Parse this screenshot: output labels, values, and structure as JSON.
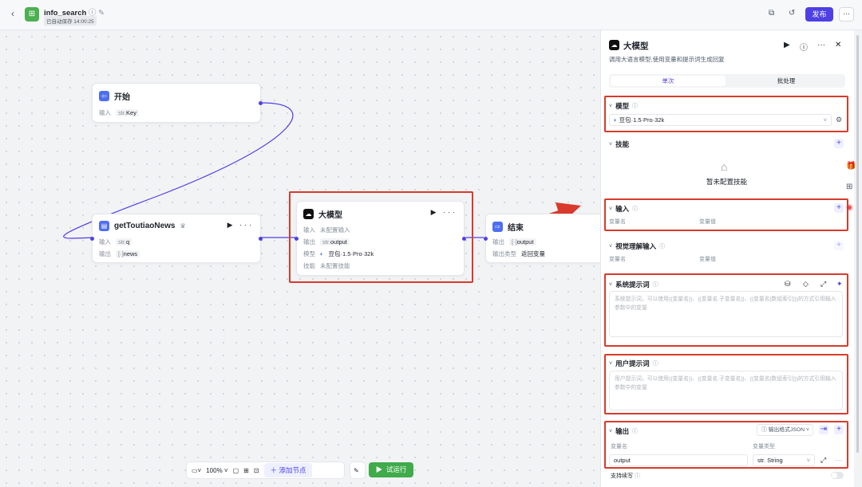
{
  "app": {
    "title": "info_search",
    "autosave": "已自动保存 14:00:25",
    "publish_label": "发布",
    "back_icon": "chevron-left-icon"
  },
  "colors": {
    "accent": "#4e40e5",
    "highlight": "#d93a2b",
    "run": "#3fab4b"
  },
  "nodes": {
    "start": {
      "title": "开始",
      "input_label": "输入",
      "input_type": "str.",
      "input_value": "Key"
    },
    "tool": {
      "title": "getToutiaoNews",
      "input_label": "输入",
      "input_type": "str.",
      "input_value": "q",
      "output_label": "输出",
      "output_type": "[·]",
      "output_value": "news"
    },
    "llm": {
      "title": "大模型",
      "input_label": "输入",
      "input_value": "未配置输入",
      "output_label": "输出",
      "output_type": "str.",
      "output_value": "output",
      "model_label": "模型",
      "model_value": "豆包·1.5·Pro·32k",
      "skill_label": "技能",
      "skill_value": "未配置技能"
    },
    "end": {
      "title": "结束",
      "output_label": "输出",
      "output_type": "[·]",
      "output_value": "output",
      "out_type_label": "输出类型",
      "out_type_value": "返回变量"
    }
  },
  "toolbar": {
    "zoom": "100%",
    "add_node": "添加节点",
    "test_run": "试运行"
  },
  "panel": {
    "title": "大模型",
    "desc": "调用大语言模型,使用变量和提示词生成回复",
    "tabs": [
      "单次",
      "批处理"
    ],
    "model": {
      "label": "模型",
      "value": "豆包·1.5·Pro·32k"
    },
    "skills": {
      "label": "技能",
      "empty": "暂未配置技能"
    },
    "input": {
      "label": "输入",
      "col_name": "变量名",
      "col_value": "变量值"
    },
    "vision_input": {
      "label": "视觉理解输入",
      "col_name": "变量名",
      "col_value": "变量值"
    },
    "system_prompt": {
      "label": "系统提示词",
      "placeholder": "系统提示词，可以使用{{变量名}}、{{变量名.子变量名}}、{{变量名[数组索引]}}的方式引用输入参数中的变量"
    },
    "user_prompt": {
      "label": "用户提示词",
      "placeholder": "用户提示词，可以使用{{变量名}}、{{变量名.子变量名}}、{{变量名[数组索引]}}的方式引用输入参数中的变量"
    },
    "output": {
      "label": "输出",
      "format": "输出格式JSON",
      "col_name": "变量名",
      "col_type": "变量类型",
      "var_name": "output",
      "var_type": "str. String"
    },
    "retry": {
      "label": "支持续写"
    }
  }
}
